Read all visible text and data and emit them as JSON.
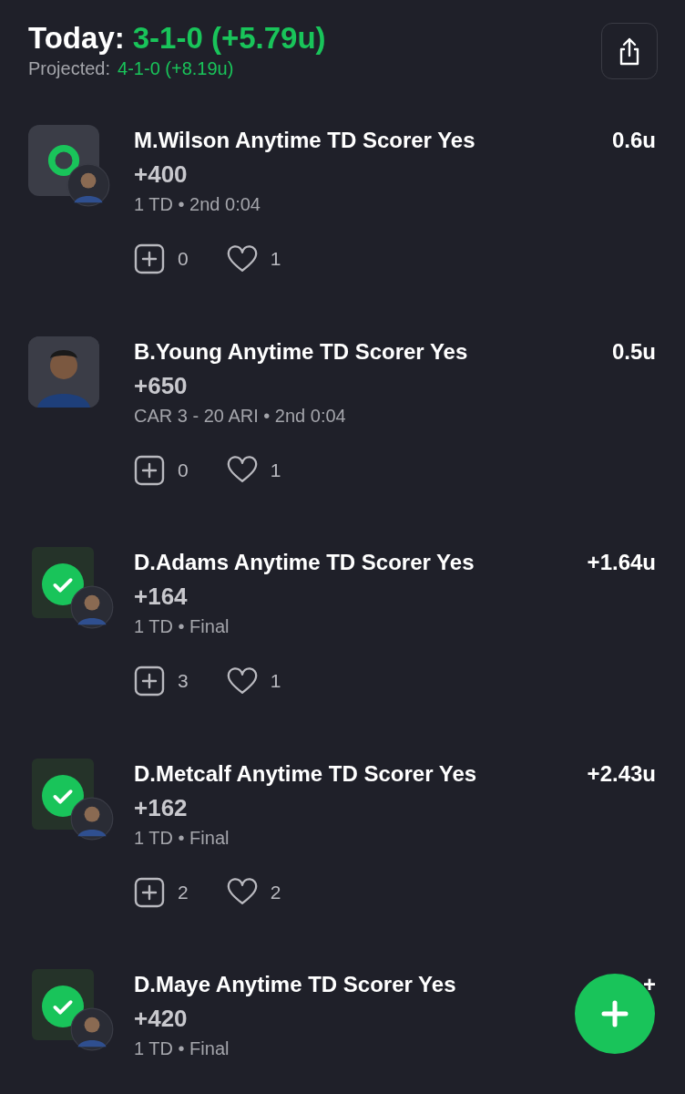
{
  "header": {
    "label": "Today:",
    "record": "3-1-0 (+5.79u)",
    "projected_label": "Projected:",
    "projected_record": "4-1-0 (+8.19u)"
  },
  "bets": [
    {
      "kind": "pending",
      "title": "M.Wilson Anytime TD Scorer Yes",
      "odds": "+400",
      "amount": "0.6u",
      "status": "1 TD • 2nd 0:04",
      "adds": "0",
      "likes": "1"
    },
    {
      "kind": "player",
      "title": "B.Young Anytime TD Scorer Yes",
      "odds": "+650",
      "amount": "0.5u",
      "status": "CAR 3 - 20 ARI • 2nd 0:04",
      "adds": "0",
      "likes": "1"
    },
    {
      "kind": "won",
      "title": "D.Adams Anytime TD Scorer Yes",
      "odds": "+164",
      "amount": "+1.64u",
      "status": "1 TD • Final",
      "adds": "3",
      "likes": "1"
    },
    {
      "kind": "won",
      "title": "D.Metcalf Anytime TD Scorer Yes",
      "odds": "+162",
      "amount": "+2.43u",
      "status": "1 TD • Final",
      "adds": "2",
      "likes": "2"
    },
    {
      "kind": "won",
      "title": "D.Maye Anytime TD Scorer Yes",
      "odds": "+420",
      "amount": "+",
      "status": "1 TD • Final"
    }
  ]
}
